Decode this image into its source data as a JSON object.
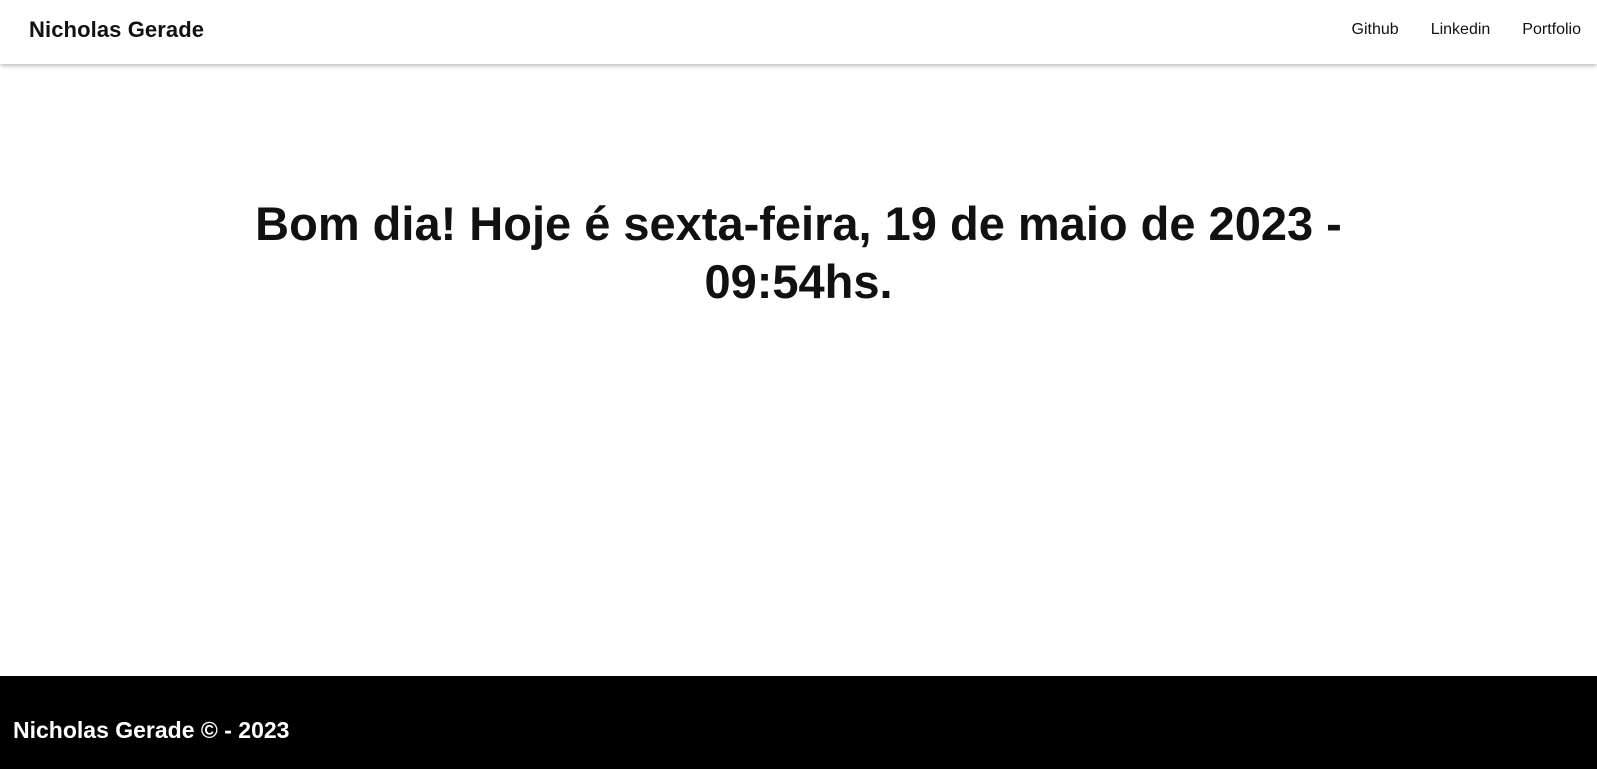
{
  "header": {
    "brand": "Nicholas Gerade",
    "nav": [
      {
        "label": "Github"
      },
      {
        "label": "Linkedin"
      },
      {
        "label": "Portfolio"
      }
    ]
  },
  "main": {
    "greeting_line1": "Bom dia! Hoje é sexta-feira, 19 de maio de 2023 -",
    "greeting_line2": "09:54hs."
  },
  "footer": {
    "text": "Nicholas Gerade © - 2023"
  },
  "colors": {
    "background": "#ffffff",
    "text": "#111111",
    "footer_bg": "#000000",
    "footer_text": "#ffffff"
  }
}
